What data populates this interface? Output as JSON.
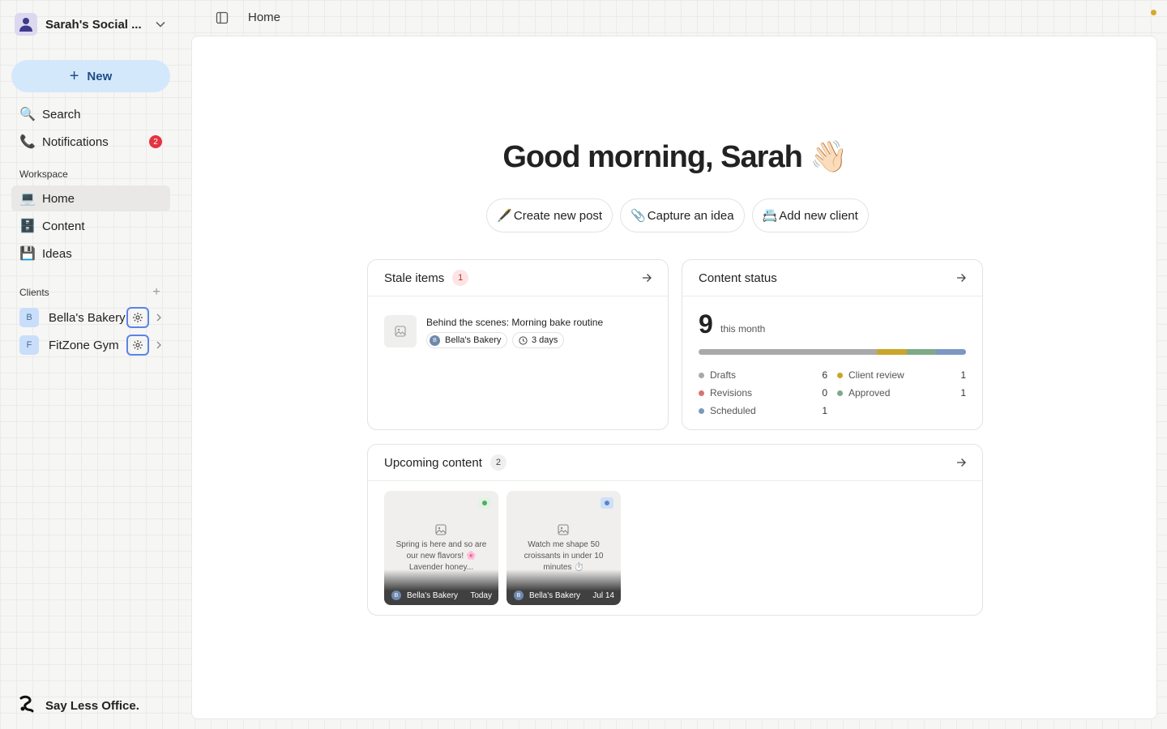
{
  "workspace": {
    "name": "Sarah's Social ..."
  },
  "sidebar": {
    "new_label": "New",
    "search_label": "Search",
    "notifications_label": "Notifications",
    "notifications_count": "2",
    "workspace_heading": "Workspace",
    "nav": [
      {
        "label": "Home",
        "icon": "💻"
      },
      {
        "label": "Content",
        "icon": "🗄️"
      },
      {
        "label": "Ideas",
        "icon": "💾"
      }
    ],
    "clients_heading": "Clients",
    "clients": [
      {
        "initial": "B",
        "name": "Bella's Bakery"
      },
      {
        "initial": "F",
        "name": "FitZone Gym"
      }
    ],
    "brand": "Say Less Office."
  },
  "topbar": {
    "breadcrumb": "Home"
  },
  "main": {
    "greeting": "Good morning, Sarah 👋🏻",
    "actions": [
      {
        "emoji": "🖋️",
        "label": "Create new post"
      },
      {
        "emoji": "📎",
        "label": "Capture an idea"
      },
      {
        "emoji": "📇",
        "label": "Add new client"
      }
    ],
    "stale": {
      "title": "Stale items",
      "count": "1",
      "item": {
        "title": "Behind the scenes: Morning bake routine",
        "client_initial": "B",
        "client": "Bella's Bakery",
        "age": "3 days"
      }
    },
    "content_status": {
      "title": "Content status",
      "total": "9",
      "total_sub": "this month",
      "legend": [
        {
          "label": "Drafts",
          "value": "6",
          "color": "#a9a9a7"
        },
        {
          "label": "Client review",
          "value": "1",
          "color": "#c9a52a"
        },
        {
          "label": "Revisions",
          "value": "0",
          "color": "#d8736f"
        },
        {
          "label": "Approved",
          "value": "1",
          "color": "#7fa98a"
        },
        {
          "label": "Scheduled",
          "value": "1",
          "color": "#7b98bf"
        }
      ]
    },
    "upcoming": {
      "title": "Upcoming content",
      "count": "2",
      "cards": [
        {
          "text": "Spring is here and so are our new flavors! 🌸 Lavender honey...",
          "client_initial": "B",
          "client": "Bella's Bakery",
          "date": "Today",
          "status_color": "#4fae62",
          "status_bg": "#e3f2e4"
        },
        {
          "text": "Watch me shape 50 croissants in under 10 minutes ⏱️",
          "client_initial": "B",
          "client": "Bella's Bakery",
          "date": "Jul 14",
          "status_color": "#5b86c8",
          "status_bg": "#cfe0f6"
        }
      ]
    }
  }
}
